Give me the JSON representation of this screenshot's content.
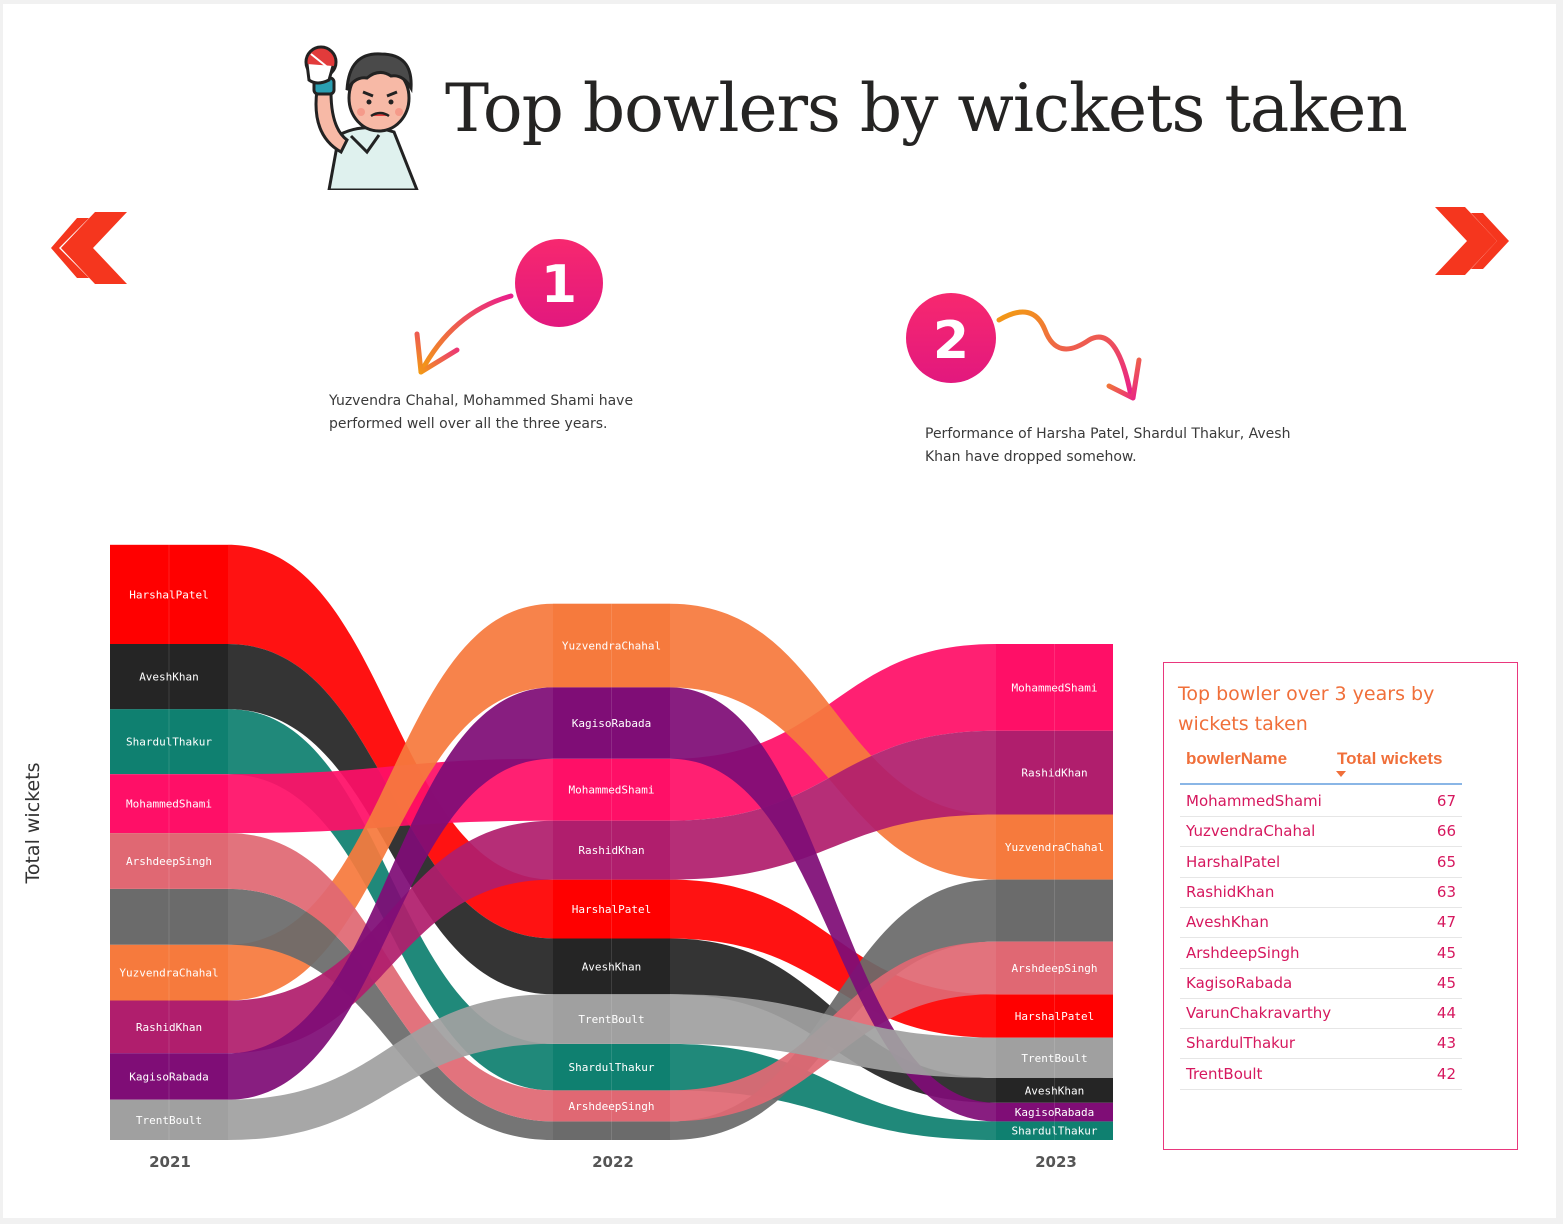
{
  "page": {
    "title": "Top bowlers by wickets taken"
  },
  "annotations": [
    {
      "number": "1",
      "text": "Yuzvendra Chahal, Mohammed Shami have performed well  over all the three years."
    },
    {
      "number": "2",
      "text": "Performance of Harsha Patel, Shardul Thakur, Avesh Khan have dropped somehow."
    }
  ],
  "nav": {
    "prev_icon": "double-chevron-left-icon",
    "next_icon": "double-chevron-right-icon",
    "color": "#f5361e"
  },
  "chart_data": {
    "type": "ribbon",
    "ylabel": "Total wickets",
    "categories": [
      "2021",
      "2022",
      "2023"
    ],
    "series": [
      {
        "name": "HarshalPatel",
        "color": "#ff0000",
        "values": [
          32,
          19,
          14
        ]
      },
      {
        "name": "ShardulThakur",
        "color": "#0f8070",
        "values": [
          21,
          15,
          6
        ]
      },
      {
        "name": "AveshKhan",
        "color": "#252525",
        "values": [
          21,
          18,
          8
        ]
      },
      {
        "name": "MohammedShami",
        "color": "#ff0f67",
        "values": [
          19,
          20,
          28
        ]
      },
      {
        "name": "YuzvendraChahal",
        "color": "#f67a3d",
        "values": [
          18,
          27,
          21
        ]
      },
      {
        "name": "VarunChakravarthy",
        "color": "#6b6b6b",
        "values": [
          18,
          6,
          20
        ]
      },
      {
        "name": "ArshdeepSingh",
        "color": "#e06873",
        "values": [
          18,
          10,
          17
        ]
      },
      {
        "name": "RashidKhan",
        "color": "#b01e6d",
        "values": [
          17,
          19,
          27
        ]
      },
      {
        "name": "KagisoRabada",
        "color": "#7f0d76",
        "values": [
          15,
          23,
          6
        ]
      },
      {
        "name": "TrentBoult",
        "color": "#a0a0a0",
        "values": [
          13,
          16,
          13
        ]
      }
    ]
  },
  "table": {
    "title": "Top bowler over 3 years by wickets taken",
    "columns": [
      "bowlerName",
      "Total wickets"
    ],
    "rows": [
      {
        "name": "MohammedShami",
        "value": "67"
      },
      {
        "name": "YuzvendraChahal",
        "value": "66"
      },
      {
        "name": "HarshalPatel",
        "value": "65"
      },
      {
        "name": "RashidKhan",
        "value": "63"
      },
      {
        "name": "AveshKhan",
        "value": "47"
      },
      {
        "name": "ArshdeepSingh",
        "value": "45"
      },
      {
        "name": "KagisoRabada",
        "value": "45"
      },
      {
        "name": "VarunChakravarthy",
        "value": "44"
      },
      {
        "name": "ShardulThakur",
        "value": "43"
      },
      {
        "name": "TrentBoult",
        "value": "42"
      }
    ]
  }
}
